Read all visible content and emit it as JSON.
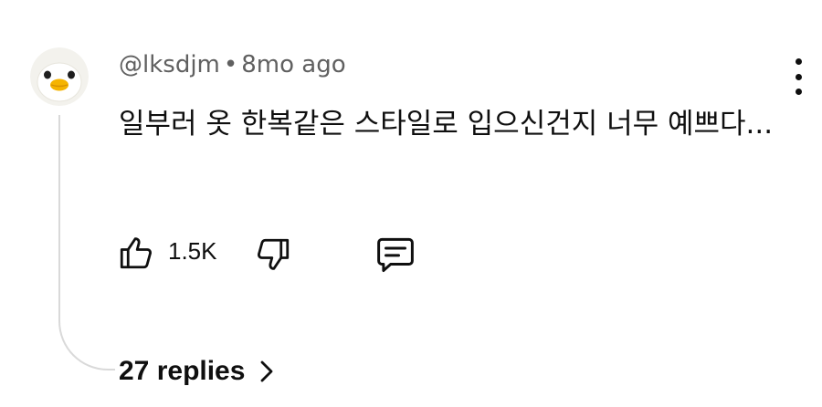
{
  "comment": {
    "author": "@lksdjm",
    "separator": "•",
    "time_ago": "8mo ago",
    "text": "일부러 옷 한복같은 스타일로 입으신건지 너무 예쁘다...",
    "avatar_icon": "duck-avatar-icon"
  },
  "actions": {
    "like_count": "1.5K",
    "like_icon": "thumbs-up-icon",
    "dislike_icon": "thumbs-down-icon",
    "reply_icon": "comment-icon",
    "more_icon": "more-vertical-icon"
  },
  "replies": {
    "label": "27 replies",
    "icon": "chevron-right-icon"
  },
  "colors": {
    "text": "#0f0f0f",
    "secondary_text": "#606060",
    "thread_line": "#d9d9d9",
    "avatar_bg": "#f2f1ec",
    "duck_beak": "#f5b400"
  }
}
